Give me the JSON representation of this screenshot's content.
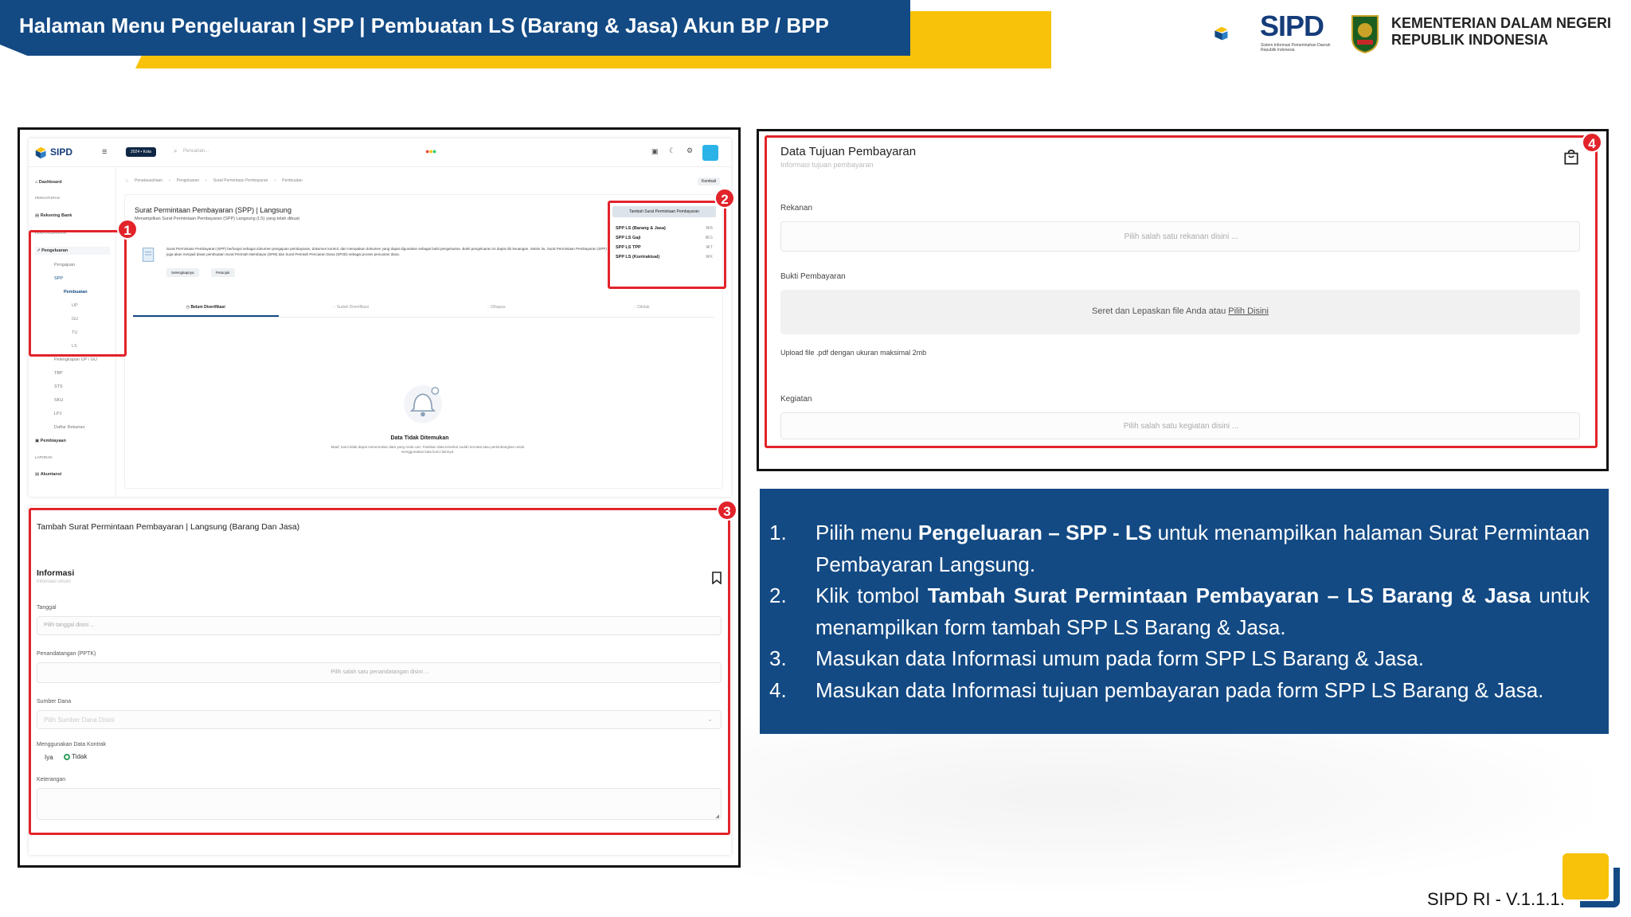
{
  "header": {
    "title": "Halaman Menu Pengeluaran | SPP | Pembuatan LS (Barang & Jasa) Akun BP / BPP",
    "logo_text": "SIPD",
    "logo_subtitle": "Sistem Informasi Pemerintahan Daerah Republik Indonesia",
    "ministry_line1": "KEMENTERIAN DALAM NEGERI",
    "ministry_line2": "REPUBLIK INDONESIA"
  },
  "shot1": {
    "app_logo": "SIPD",
    "year_badge": "2024 • Kota",
    "search_placeholder": "Pencarian...",
    "sidebar": {
      "dashboard": "Dashboard",
      "section_pengaturan": "PENGATURAN",
      "rekening_bank": "Rekening Bank",
      "section_penatausahaan": "PENATAUSAHAAN",
      "pengeluaran": "Pengeluaran",
      "pengajuan": "Pengajuan",
      "spp": "SPP",
      "pembuatan": "Pembuatan",
      "up": "UP",
      "gu": "GU",
      "tu": "TU",
      "ls": "LS",
      "pelengkapan": "Pelengkapan UP / GU",
      "tbp": "TBP",
      "sts": "STS",
      "sku": "SKU",
      "lpj": "LPJ",
      "daftar_rekanan": "Daftar Rekanan",
      "pembiayaan": "Pembiayaan",
      "section_laporan": "LAPORAN",
      "akuntansi": "Akuntansi"
    },
    "breadcrumb": [
      "Penatausahaan",
      "Pengeluaran",
      "Surat Permintaan Pembayaran",
      "Pembuatan"
    ],
    "back_button": "Kembali",
    "page_title": "Surat Permintaan Pembayaran (SPP) | Langsung",
    "page_subtitle": "Menampilkan Surat Permintaan Pembayaran (SPP) Langsung (LS) yang telah dibuat",
    "description": "Surat Permintaan Pembayaran (SPP) berfungsi sebagai dokumen pengajuan pembayaran, dokumen kontrol, dan merupakan dokumen yang dapat digunakan sebagai bukti pengeluaran. Bukti pengeluaran ini dapat diri keuangan. Selain itu, Surat Permintaan Pembayaran (SPP) juga akan menjadi dasar pembuatan Surat Perintah Membayar (SPM) dan Surat Perintah Pencairan Dana (SP2D) sebagai proses pencairan dana.",
    "btn_selengkapnya": "Selengkapnya",
    "btn_panduan": "Petunjuk",
    "add_button": "Tambah Surat Permintaan Pembayaran",
    "add_menu": [
      {
        "label": "SPP LS (Barang & Jasa)",
        "shortcut": "⌘B"
      },
      {
        "label": "SPP LS Gaji",
        "shortcut": "⌘G"
      },
      {
        "label": "SPP LS TPP",
        "shortcut": "⌘T"
      },
      {
        "label": "SPP LS (Kontraktual)",
        "shortcut": "⌘K"
      }
    ],
    "tabs": [
      "Belum Diverifikasi",
      "Sudah Diverifikasi",
      "Dihapus",
      "Ditolak"
    ],
    "empty_title": "Data Tidak Ditemukan",
    "empty_text": "Maaf, kami tidak dapat menemukan data yang Anda cari. Pastikan data tersebut sudah tercatat atau pertimbangkan untuk menggunakan kata kunci lainnya."
  },
  "shot3": {
    "title": "Tambah Surat Permintaan Pembayaran | Langsung (Barang Dan Jasa)",
    "section": "Informasi",
    "section_sub": "Informasi umum",
    "tanggal_label": "Tanggal",
    "tanggal_placeholder": "Pilih tanggal disini ...",
    "pptk_label": "Penandatangan (PPTK)",
    "pptk_placeholder": "Pilih salah satu penandatangan disini ...",
    "sumber_label": "Sumber Dana",
    "sumber_placeholder": "Pilih Sumber Dana Disini",
    "kontrak_label": "Menggunakan Data Kontrak",
    "opt_iya": "Iya",
    "opt_tidak": "Tidak",
    "keterangan_label": "Keterangan"
  },
  "shot4": {
    "title": "Data Tujuan Pembayaran",
    "subtitle": "Informasi tujuan pembayaran",
    "rekanan_label": "Rekanan",
    "rekanan_placeholder": "Pilih salah satu rekanan disini ...",
    "bukti_label": "Bukti Pembayaran",
    "upload_text": "Seret dan Lepaskan file Anda atau",
    "upload_link": "Pilih Disini",
    "upload_hint": "Upload file .pdf dengan ukuran maksimal 2mb",
    "kegiatan_label": "Kegiatan",
    "kegiatan_placeholder": "Pilih salah satu kegiatan disini ..."
  },
  "badges": [
    "1",
    "2",
    "3",
    "4"
  ],
  "instructions": [
    {
      "num": "1.",
      "pre": "Pilih menu ",
      "bold": "Pengeluaran – SPP - LS",
      "post": " untuk menampilkan halaman Surat Permintaan Pembayaran Langsung."
    },
    {
      "num": "2.",
      "pre": "Klik tombol ",
      "bold": "Tambah Surat Permintaan Pembayaran – LS Barang & Jasa",
      "post": " untuk menampilkan form tambah SPP LS Barang & Jasa."
    },
    {
      "num": "3.",
      "pre": "Masukan data Informasi umum pada form SPP LS Barang & Jasa.",
      "bold": "",
      "post": ""
    },
    {
      "num": "4.",
      "pre": "Masukan data Informasi tujuan pembayaran pada form SPP LS Barang & Jasa.",
      "bold": "",
      "post": ""
    }
  ],
  "footer": {
    "version": "SIPD RI - V.1.1.1."
  },
  "colors": {
    "brand_blue": "#134a84",
    "accent_yellow": "#f8c20a",
    "highlight_red": "#e2232a"
  }
}
